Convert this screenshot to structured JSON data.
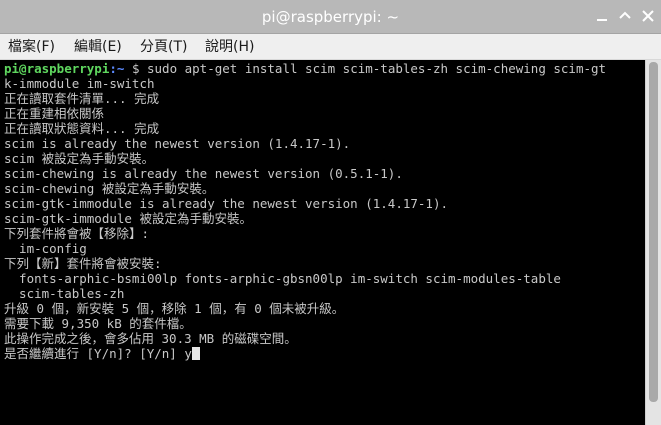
{
  "window": {
    "title": "pi@raspberrypi: ~"
  },
  "menu": [
    {
      "label": "檔案(F)"
    },
    {
      "label": "編輯(E)"
    },
    {
      "label": "分頁(T)"
    },
    {
      "label": "說明(H)"
    }
  ],
  "terminal": {
    "prompt_user": "pi@raspberrypi",
    "prompt_sep": ":",
    "prompt_path": "~",
    "prompt_symbol": " $ ",
    "command_line_1": "sudo apt-get install scim scim-tables-zh scim-chewing scim-gt",
    "command_line_2": "k-immodule im-switch",
    "output": [
      "正在讀取套件清單... 完成",
      "正在重建相依關係",
      "正在讀取狀態資料... 完成",
      "scim is already the newest version (1.4.17-1).",
      "scim 被設定為手動安裝。",
      "scim-chewing is already the newest version (0.5.1-1).",
      "scim-chewing 被設定為手動安裝。",
      "scim-gtk-immodule is already the newest version (1.4.17-1).",
      "scim-gtk-immodule 被設定為手動安裝。",
      "下列套件將會被【移除】:",
      "  im-config",
      "下列【新】套件將會被安裝:",
      "  fonts-arphic-bsmi00lp fonts-arphic-gbsn00lp im-switch scim-modules-table",
      "  scim-tables-zh",
      "升級 0 個，新安裝 5 個，移除 1 個，有 0 個未被升級。",
      "需要下載 9,350 kB 的套件檔。",
      "此操作完成之後，會多佔用 30.3 MB 的磁碟空間。",
      "是否繼續進行 [Y/n]? [Y/n] y"
    ]
  },
  "colors": {
    "titlebar": "#b8b8b8",
    "menubar": "#efefef",
    "terminal_bg": "#000000",
    "terminal_fg": "#c8c8c8",
    "prompt_user": "#5fd75f",
    "prompt_path": "#5c8aff"
  },
  "icons": {
    "minimize": "minimize-icon",
    "maximize": "maximize-icon",
    "close": "close-icon"
  }
}
